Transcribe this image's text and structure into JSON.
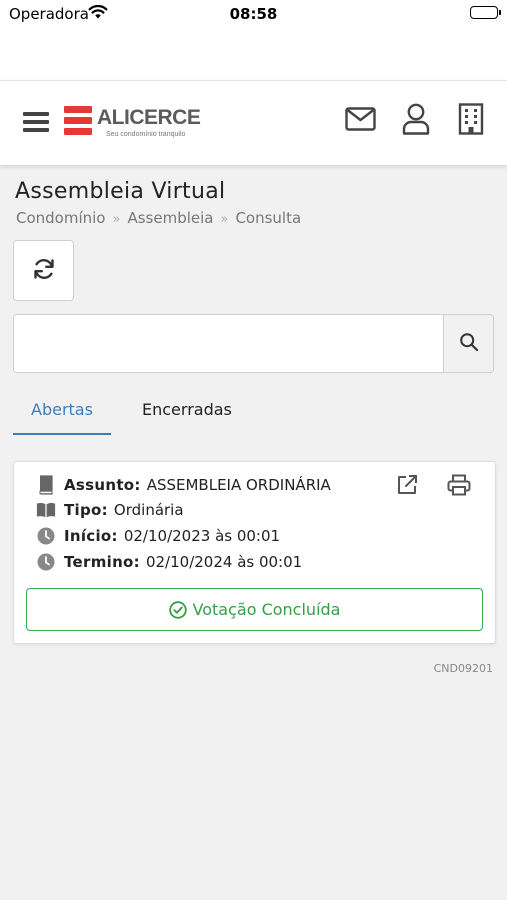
{
  "status_bar": {
    "carrier": "Operadora",
    "time": "08:58"
  },
  "header": {
    "logo_text": "ALICERCE",
    "logo_tagline": "Seu condomínio tranquilo",
    "icons": [
      "menu-icon",
      "mail-icon",
      "user-icon",
      "building-icon"
    ]
  },
  "page": {
    "title": "Assembleia Virtual",
    "breadcrumb": [
      "Condomínio",
      "Assembleia",
      "Consulta"
    ]
  },
  "search": {
    "value": "",
    "placeholder": ""
  },
  "tabs": [
    {
      "label": "Abertas",
      "active": true
    },
    {
      "label": "Encerradas",
      "active": false
    }
  ],
  "card": {
    "assunto_label": "Assunto:",
    "assunto_value": "ASSEMBLEIA ORDINÁRIA",
    "tipo_label": "Tipo:",
    "tipo_value": "Ordinária",
    "inicio_label": "Início:",
    "inicio_value": "02/10/2023 às 00:01",
    "termino_label": "Termino:",
    "termino_value": "02/10/2024 às 00:01",
    "status": "Votação Concluída"
  },
  "screen_code": "CND09201",
  "colors": {
    "accent": "#3b7ec0",
    "success": "#36a047",
    "brand": "#e53935"
  }
}
